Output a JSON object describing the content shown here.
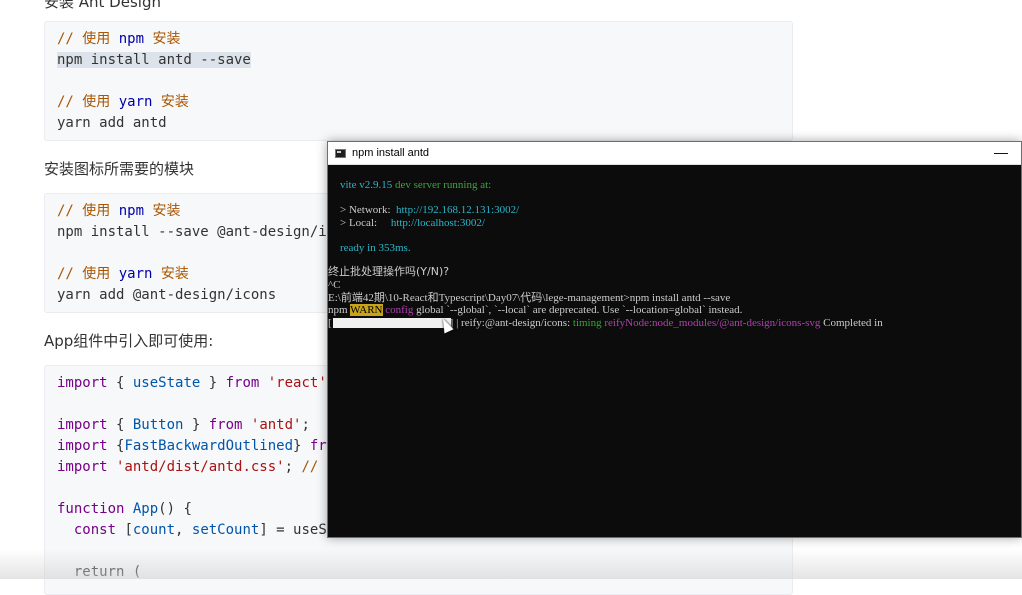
{
  "doc": {
    "heading_cut": "安装 Ant Design",
    "block1": {
      "line1_comment": "// 使用 ",
      "line1_kw": "npm",
      "line1_tail": " 安装",
      "line2": "npm install antd --save",
      "line4_comment": "// 使用 ",
      "line4_kw": "yarn",
      "line4_tail": " 安装",
      "line5": "yarn add antd"
    },
    "text_icons": "安装图标所需要的模块",
    "block2": {
      "line1_comment": "// 使用 ",
      "line1_kw": "npm",
      "line1_tail": " 安装",
      "line2": "npm install --save @ant-design/icons",
      "line4_comment": "// 使用 ",
      "line4_kw": "yarn",
      "line4_tail": " 安装",
      "line5": "yarn add @ant-design/icons"
    },
    "text_app": "App组件中引入即可使用:",
    "block3": {
      "l1_import": "import",
      "l1_mid": " { ",
      "l1_name": "useState",
      "l1_mid2": " } ",
      "l1_from": "from",
      "l1_str": " 'react'",
      "l2_import": "import",
      "l2_mid": " { ",
      "l2_name": "Button",
      "l2_mid2": " } ",
      "l2_from": "from",
      "l2_str": " 'antd'",
      "l2_end": ";",
      "l3_import": "import",
      "l3_mid": " {",
      "l3_name": "FastBackwardOutlined",
      "l3_mid2": "} ",
      "l3_from": "from",
      "l4_import": "import",
      "l4_str": " 'antd/dist/antd.css'",
      "l4_end": "; ",
      "l4_cm": "// or",
      "l5_fn": "function",
      "l5_name": " App",
      "l5_end": "() {",
      "l6_const": "  const",
      "l6_mid": " [",
      "l6_a": "count",
      "l6_comma": ", ",
      "l6_b": "setCount",
      "l6_end": "] = useSta",
      "l7": "  return ("
    }
  },
  "terminal": {
    "title": "npm install antd",
    "minimize": "—",
    "vite_name": "vite v2.9.15",
    "vite_msg": " dev server running at:",
    "network_label": "> Network:",
    "network_url": "http://192.168.12.131:3002/",
    "local_label": "> Local:",
    "local_url": "http://localhost:3002/",
    "ready_msg": "ready in 353ms.",
    "prompt_cn": "终止批处理操作吗(Y/N)?",
    "ctrl_c": "^C",
    "command_line": "E:\\前端42期\\10-React和Typescript\\Day07\\代码\\lege-management>npm install antd --save",
    "warn_npm": "npm ",
    "warn_tag": "WARN",
    "warn_config": " config",
    "warn_rest": " global `--global`, `--local` are deprecated. Use `--location=global` instead.",
    "progress_open": "[",
    "progress_close": "] | reify:@ant-design/icons: ",
    "timing_word": "timing",
    "timing_space": " ",
    "reify_path": "reifyNode:node_modules/@ant-design/icons-svg",
    "completed": " Completed in"
  }
}
